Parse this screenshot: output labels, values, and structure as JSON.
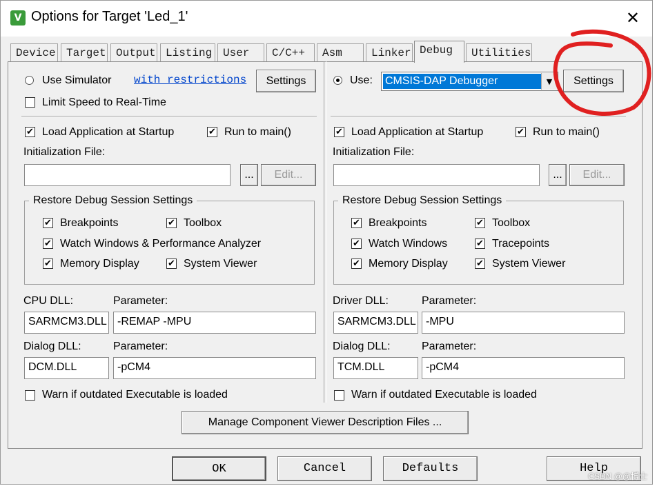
{
  "window": {
    "title": "Options for Target 'Led_1'",
    "close_glyph": "✕",
    "app_icon": "V"
  },
  "tabs": [
    {
      "label": "Device"
    },
    {
      "label": "Target"
    },
    {
      "label": "Output"
    },
    {
      "label": "Listing"
    },
    {
      "label": "User"
    },
    {
      "label": "C/C++"
    },
    {
      "label": "Asm"
    },
    {
      "label": "Linker"
    },
    {
      "label": "Debug",
      "active": true
    },
    {
      "label": "Utilities"
    }
  ],
  "left": {
    "use_simulator": "Use Simulator",
    "with_restrictions": "with restrictions",
    "settings": "Settings",
    "limit_speed": "Limit Speed to Real-Time",
    "load_app": "Load Application at Startup",
    "run_to_main": "Run to main()",
    "init_file": "Initialization File:",
    "init_value": "",
    "browse": "...",
    "edit": "Edit...",
    "restore_group": "Restore Debug Session Settings",
    "breakpoints": "Breakpoints",
    "toolbox": "Toolbox",
    "watch": "Watch Windows & Performance Analyzer",
    "memory": "Memory Display",
    "sysviewer": "System Viewer",
    "cpu_dll_label": "CPU DLL:",
    "param_label": "Parameter:",
    "cpu_dll": "SARMCM3.DLL",
    "cpu_param": "-REMAP -MPU",
    "dialog_dll_label": "Dialog DLL:",
    "dialog_dll": "DCM.DLL",
    "dialog_param": "-pCM4",
    "warn": "Warn if outdated Executable is loaded"
  },
  "right": {
    "use": "Use:",
    "debugger": "CMSIS-DAP Debugger",
    "settings": "Settings",
    "load_app": "Load Application at Startup",
    "run_to_main": "Run to main()",
    "init_file": "Initialization File:",
    "init_value": "",
    "browse": "...",
    "edit": "Edit...",
    "restore_group": "Restore Debug Session Settings",
    "breakpoints": "Breakpoints",
    "toolbox": "Toolbox",
    "watch": "Watch Windows",
    "tracepoints": "Tracepoints",
    "memory": "Memory Display",
    "sysviewer": "System Viewer",
    "driver_dll_label": "Driver DLL:",
    "param_label": "Parameter:",
    "driver_dll": "SARMCM3.DLL",
    "driver_param": "-MPU",
    "dialog_dll_label": "Dialog DLL:",
    "dialog_dll": "TCM.DLL",
    "dialog_param": "-pCM4",
    "warn": "Warn if outdated Executable is loaded"
  },
  "manage_button": "Manage Component Viewer Description Files ...",
  "footer": {
    "ok": "OK",
    "cancel": "Cancel",
    "defaults": "Defaults",
    "help": "Help"
  },
  "checks": {
    "check_glyph": "✔"
  },
  "watermark": "CSDN @@博士",
  "colors": {
    "annotation": "#e02020",
    "selection": "#0078d7",
    "link": "#0044cc"
  }
}
